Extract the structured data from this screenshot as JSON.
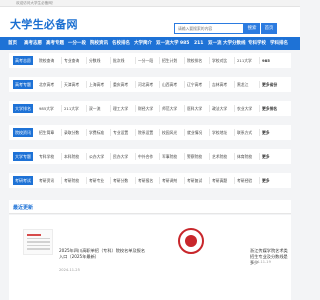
{
  "topbar": {
    "text": "欢迎访问大学生必备网！"
  },
  "header": {
    "logo": "大学生必备网",
    "search_placeholder": "请输入要搜索的内容",
    "search_button": "搜索",
    "home_button": "首页"
  },
  "nav": {
    "items": [
      "首页",
      "高考志愿",
      "高考专题",
      "一分一段",
      "院校资讯",
      "名校排名",
      "大学简介",
      "双一流大学",
      "985",
      "211",
      "双一流",
      "大学分数线",
      "专科学校",
      "学科排名",
      "联考",
      "招生",
      "专题"
    ]
  },
  "categories": [
    {
      "label": "高考志愿",
      "links": [
        "院校查询",
        "专业查询",
        "分数线",
        "批次线",
        "一分一段",
        "招生计划",
        "院校排名",
        "学校对比",
        "211大学",
        "985"
      ]
    },
    {
      "label": "高考专题",
      "links": [
        "北京高考",
        "天津高考",
        "上海高考",
        "重庆高考",
        "河北高考",
        "山西高考",
        "辽宁高考",
        "吉林高考",
        "黑龙江",
        "更多省份"
      ]
    },
    {
      "label": "大学排名",
      "links": [
        "985大学",
        "211大学",
        "双一流",
        "理工大学",
        "财经大学",
        "师范大学",
        "医科大学",
        "政法大学",
        "农业大学",
        "更多排名"
      ]
    },
    {
      "label": "院校资讯",
      "links": [
        "招生简章",
        "录取分数",
        "学费标准",
        "专业设置",
        "院系设置",
        "校园风光",
        "就业情况",
        "学校地址",
        "联系方式",
        "更多"
      ]
    },
    {
      "label": "大学专题",
      "links": [
        "专科学校",
        "本科院校",
        "公办大学",
        "民办大学",
        "中外合作",
        "军事院校",
        "警察院校",
        "艺术院校",
        "体育院校",
        "更多"
      ]
    },
    {
      "label": "考研考试",
      "links": [
        "考研资讯",
        "考研院校",
        "考研专业",
        "考研分数",
        "考研报名",
        "考研调剂",
        "考研复试",
        "考研真题",
        "考研经验",
        "更多"
      ]
    }
  ],
  "latest": {
    "title": "最近更新",
    "items": [
      {
        "title": "2025年四川高职单招（专科）院校名单及报名入口（2025年最新）",
        "date": "2024-11-25"
      },
      {
        "title": "浙江传媒学院艺术类招生专业及分数线是多少",
        "date": "2024-11-19"
      }
    ]
  }
}
